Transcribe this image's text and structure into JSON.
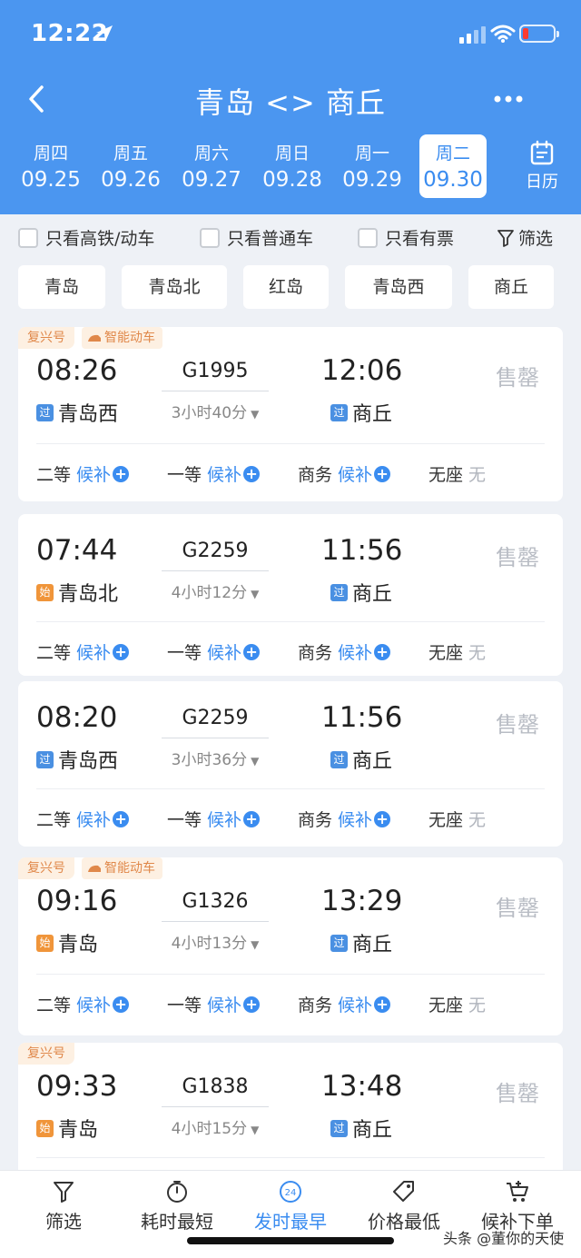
{
  "status_bar": {
    "time": "12:22"
  },
  "nav": {
    "title": "青岛 <> 商丘"
  },
  "dates": [
    {
      "weekday": "周四",
      "date": "09.25"
    },
    {
      "weekday": "周五",
      "date": "09.26"
    },
    {
      "weekday": "周六",
      "date": "09.27"
    },
    {
      "weekday": "周日",
      "date": "09.28"
    },
    {
      "weekday": "周一",
      "date": "09.29"
    },
    {
      "weekday": "周二",
      "date": "09.30"
    }
  ],
  "calendar_label": "日历",
  "filters": {
    "high_speed": "只看高铁/动车",
    "normal": "只看普通车",
    "available": "只看有票",
    "filter_btn": "筛选"
  },
  "stations": [
    "青岛",
    "青岛北",
    "红岛",
    "青岛西",
    "商丘"
  ],
  "trains": [
    {
      "tags": [
        "复兴号",
        "智能动车"
      ],
      "dep_time": "08:26",
      "train_no": "G1995",
      "arr_time": "12:06",
      "duration": "3小时40分",
      "dep_badge": "过",
      "dep_station": "青岛西",
      "arr_badge": "过",
      "arr_station": "商丘",
      "status": "售罄",
      "seats": [
        {
          "label": "二等",
          "status": "候补"
        },
        {
          "label": "一等",
          "status": "候补"
        },
        {
          "label": "商务",
          "status": "候补"
        },
        {
          "label": "无座",
          "status": "无"
        }
      ]
    },
    {
      "tags": [],
      "dep_time": "07:44",
      "train_no": "G2259",
      "arr_time": "11:56",
      "duration": "4小时12分",
      "dep_badge": "始",
      "dep_station": "青岛北",
      "arr_badge": "过",
      "arr_station": "商丘",
      "status": "售罄",
      "seats": [
        {
          "label": "二等",
          "status": "候补"
        },
        {
          "label": "一等",
          "status": "候补"
        },
        {
          "label": "商务",
          "status": "候补"
        },
        {
          "label": "无座",
          "status": "无"
        }
      ]
    },
    {
      "tags": [],
      "dep_time": "08:20",
      "train_no": "G2259",
      "arr_time": "11:56",
      "duration": "3小时36分",
      "dep_badge": "过",
      "dep_station": "青岛西",
      "arr_badge": "过",
      "arr_station": "商丘",
      "status": "售罄",
      "seats": [
        {
          "label": "二等",
          "status": "候补"
        },
        {
          "label": "一等",
          "status": "候补"
        },
        {
          "label": "商务",
          "status": "候补"
        },
        {
          "label": "无座",
          "status": "无"
        }
      ]
    },
    {
      "tags": [
        "复兴号",
        "智能动车"
      ],
      "dep_time": "09:16",
      "train_no": "G1326",
      "arr_time": "13:29",
      "duration": "4小时13分",
      "dep_badge": "始",
      "dep_station": "青岛",
      "arr_badge": "过",
      "arr_station": "商丘",
      "status": "售罄",
      "seats": [
        {
          "label": "二等",
          "status": "候补"
        },
        {
          "label": "一等",
          "status": "候补"
        },
        {
          "label": "商务",
          "status": "候补"
        },
        {
          "label": "无座",
          "status": "无"
        }
      ]
    },
    {
      "tags": [
        "复兴号"
      ],
      "dep_time": "09:33",
      "train_no": "G1838",
      "arr_time": "13:48",
      "duration": "4小时15分",
      "dep_badge": "始",
      "dep_station": "青岛",
      "arr_badge": "过",
      "arr_station": "商丘",
      "status": "售罄",
      "seats": []
    }
  ],
  "toolbar": {
    "filter": "筛选",
    "shortest": "耗时最短",
    "earliest": "发时最早",
    "earliest_icon_text": "24",
    "cheapest": "价格最低",
    "waitlist": "候补下单"
  },
  "watermark": "头条 @董你的天使"
}
